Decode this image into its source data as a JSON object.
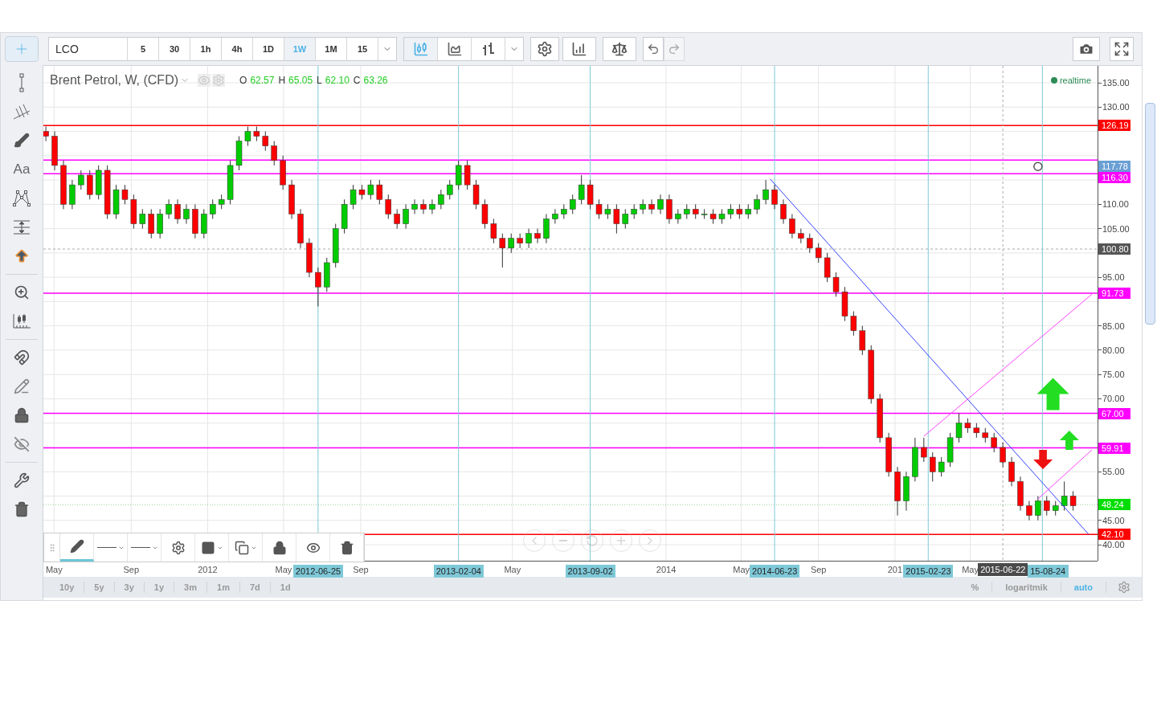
{
  "toolbar": {
    "symbol": "LCO",
    "intervals": [
      {
        "label": "5",
        "selected": false
      },
      {
        "label": "30",
        "selected": false
      },
      {
        "label": "1h",
        "selected": false
      },
      {
        "label": "4h",
        "selected": false
      },
      {
        "label": "1D",
        "selected": false
      },
      {
        "label": "1W",
        "selected": true
      },
      {
        "label": "1M",
        "selected": false
      },
      {
        "label": "15",
        "selected": false
      }
    ],
    "chart_styles": [
      {
        "kind": "candles",
        "selected": true
      },
      {
        "kind": "area",
        "selected": false
      },
      {
        "kind": "bars",
        "selected": false
      }
    ]
  },
  "left_tool_groups": [
    [
      {
        "kind": "crosshair",
        "selected": true
      },
      {
        "kind": "segment",
        "selected": false
      },
      {
        "kind": "pitchfork",
        "selected": false
      },
      {
        "kind": "brush",
        "selected": false
      },
      {
        "kind": "text",
        "label": "Aa",
        "selected": false
      },
      {
        "kind": "pattern",
        "selected": false
      },
      {
        "kind": "measure",
        "selected": false
      },
      {
        "kind": "arrow",
        "selected": false
      }
    ],
    [
      {
        "kind": "zoom",
        "selected": false
      },
      {
        "kind": "ruler",
        "selected": false
      }
    ],
    [
      {
        "kind": "magnet",
        "selected": false
      },
      {
        "kind": "pencils",
        "selected": false
      },
      {
        "kind": "lock",
        "selected": false
      },
      {
        "kind": "hide",
        "selected": false
      }
    ],
    [
      {
        "kind": "tools",
        "selected": false
      },
      {
        "kind": "trash",
        "selected": false
      }
    ]
  ],
  "legend": {
    "title": "Brent Petrol, W, (CFD)",
    "values": [
      {
        "key": "O",
        "value": "62.57"
      },
      {
        "key": "H",
        "value": "65.05"
      },
      {
        "key": "L",
        "value": "62.10"
      },
      {
        "key": "C",
        "value": "63.26"
      }
    ]
  },
  "status": {
    "label": "realtime",
    "color": "#2e8b57"
  },
  "cursor_price": "117.78",
  "chart_data": {
    "type": "candlestick",
    "grid": true,
    "x": [
      "2011-04-18",
      "2011-05-02",
      "2011-05-16",
      "2011-05-30",
      "2011-06-13",
      "2011-06-27",
      "2011-07-11",
      "2011-07-25",
      "2011-08-08",
      "2011-08-22",
      "2011-09-05",
      "2011-09-19",
      "2011-10-03",
      "2011-10-17",
      "2011-10-31",
      "2011-11-14",
      "2011-11-28",
      "2011-12-12",
      "2011-12-26",
      "2012-01-09",
      "2012-01-23",
      "2012-02-06",
      "2012-02-20",
      "2012-03-05",
      "2012-03-19",
      "2012-04-02",
      "2012-04-16",
      "2012-04-30",
      "2012-05-14",
      "2012-05-28",
      "2012-06-11",
      "2012-06-25",
      "2012-07-09",
      "2012-07-23",
      "2012-08-06",
      "2012-08-20",
      "2012-09-03",
      "2012-09-17",
      "2012-10-01",
      "2012-10-15",
      "2012-10-29",
      "2012-11-12",
      "2012-11-26",
      "2012-12-10",
      "2012-12-24",
      "2013-01-07",
      "2013-01-21",
      "2013-02-04",
      "2013-02-18",
      "2013-03-04",
      "2013-03-18",
      "2013-04-01",
      "2013-04-15",
      "2013-04-29",
      "2013-05-13",
      "2013-05-27",
      "2013-06-10",
      "2013-06-24",
      "2013-07-08",
      "2013-07-22",
      "2013-08-05",
      "2013-08-19",
      "2013-09-02",
      "2013-09-16",
      "2013-09-30",
      "2013-10-14",
      "2013-10-28",
      "2013-11-11",
      "2013-11-25",
      "2013-12-09",
      "2013-12-23",
      "2014-01-06",
      "2014-01-20",
      "2014-02-03",
      "2014-02-17",
      "2014-03-03",
      "2014-03-17",
      "2014-03-31",
      "2014-04-14",
      "2014-04-28",
      "2014-05-12",
      "2014-05-26",
      "2014-06-09",
      "2014-06-23",
      "2014-07-07",
      "2014-07-21",
      "2014-08-04",
      "2014-08-18",
      "2014-09-01",
      "2014-09-15",
      "2014-09-29",
      "2014-10-13",
      "2014-10-27",
      "2014-11-10",
      "2014-11-24",
      "2014-12-08",
      "2014-12-22",
      "2015-01-05",
      "2015-01-19",
      "2015-02-02",
      "2015-02-16",
      "2015-03-02",
      "2015-03-16",
      "2015-03-30",
      "2015-04-13",
      "2015-04-27",
      "2015-05-11",
      "2015-05-25",
      "2015-06-08",
      "2015-06-22",
      "2015-07-06",
      "2015-07-20",
      "2015-08-03",
      "2015-08-17",
      "2015-08-31",
      "2015-09-14",
      "2015-09-28",
      "2015-10-12"
    ],
    "ohlc": [
      [
        125,
        126,
        123,
        124
      ],
      [
        124,
        125,
        117,
        118
      ],
      [
        118,
        119,
        109,
        110
      ],
      [
        110,
        115,
        109,
        114
      ],
      [
        114,
        117,
        113,
        116
      ],
      [
        116,
        117,
        111,
        112
      ],
      [
        112,
        118,
        111,
        117
      ],
      [
        117,
        118,
        107,
        108
      ],
      [
        108,
        114,
        107,
        113
      ],
      [
        113,
        114,
        110,
        111
      ],
      [
        111,
        112,
        105,
        106
      ],
      [
        106,
        109,
        105,
        108
      ],
      [
        108,
        109,
        103,
        104
      ],
      [
        104,
        109,
        103,
        108
      ],
      [
        108,
        111,
        107,
        110
      ],
      [
        110,
        111,
        106,
        107
      ],
      [
        107,
        110,
        106,
        109
      ],
      [
        109,
        110,
        103,
        104
      ],
      [
        104,
        109,
        103,
        108
      ],
      [
        108,
        111,
        107,
        110
      ],
      [
        110,
        112,
        109,
        111
      ],
      [
        111,
        119,
        110,
        118
      ],
      [
        118,
        124,
        117,
        123
      ],
      [
        123,
        126,
        122,
        125
      ],
      [
        125,
        126,
        123,
        124
      ],
      [
        124,
        125,
        121,
        122
      ],
      [
        122,
        123,
        118,
        119
      ],
      [
        119,
        120,
        113,
        114
      ],
      [
        114,
        115,
        107,
        108
      ],
      [
        108,
        109,
        101,
        102
      ],
      [
        102,
        103,
        95,
        96
      ],
      [
        96,
        97,
        89,
        93
      ],
      [
        93,
        99,
        92,
        98
      ],
      [
        98,
        106,
        97,
        105
      ],
      [
        105,
        111,
        104,
        110
      ],
      [
        110,
        114,
        109,
        113
      ],
      [
        113,
        114,
        111,
        112
      ],
      [
        112,
        115,
        111,
        114
      ],
      [
        114,
        115,
        110,
        111
      ],
      [
        111,
        112,
        107,
        108
      ],
      [
        108,
        109,
        105,
        106
      ],
      [
        106,
        110,
        105,
        109
      ],
      [
        109,
        111,
        108,
        110
      ],
      [
        110,
        111,
        108,
        109
      ],
      [
        109,
        111,
        108,
        110
      ],
      [
        110,
        113,
        109,
        112
      ],
      [
        112,
        115,
        111,
        114
      ],
      [
        114,
        119,
        113,
        118
      ],
      [
        118,
        119,
        113,
        114
      ],
      [
        114,
        115,
        109,
        110
      ],
      [
        110,
        111,
        105,
        106
      ],
      [
        106,
        107,
        102,
        103
      ],
      [
        103,
        104,
        97,
        101
      ],
      [
        101,
        104,
        100,
        103
      ],
      [
        103,
        104,
        101,
        102
      ],
      [
        102,
        105,
        101,
        104
      ],
      [
        104,
        105,
        102,
        103
      ],
      [
        103,
        108,
        102,
        107
      ],
      [
        107,
        109,
        106,
        108
      ],
      [
        108,
        110,
        107,
        109
      ],
      [
        109,
        112,
        108,
        111
      ],
      [
        111,
        116,
        110,
        114
      ],
      [
        114,
        115,
        109,
        110
      ],
      [
        110,
        111,
        107,
        108
      ],
      [
        108,
        110,
        107,
        109
      ],
      [
        109,
        110,
        104,
        106
      ],
      [
        106,
        109,
        105,
        108
      ],
      [
        108,
        110,
        107,
        109
      ],
      [
        109,
        111,
        108,
        110
      ],
      [
        110,
        111,
        108,
        109
      ],
      [
        109,
        112,
        108,
        111
      ],
      [
        111,
        112,
        106,
        107
      ],
      [
        107,
        109,
        106,
        108
      ],
      [
        108,
        110,
        107,
        109
      ],
      [
        109,
        110,
        107,
        108
      ],
      [
        108,
        109,
        107,
        108
      ],
      [
        108,
        109,
        106,
        107
      ],
      [
        107,
        109,
        106,
        108
      ],
      [
        108,
        110,
        107,
        109
      ],
      [
        109,
        110,
        107,
        108
      ],
      [
        108,
        110,
        107,
        109
      ],
      [
        109,
        112,
        108,
        111
      ],
      [
        111,
        115,
        110,
        113
      ],
      [
        113,
        114,
        109,
        110
      ],
      [
        110,
        111,
        106,
        107
      ],
      [
        107,
        108,
        103,
        104
      ],
      [
        104,
        105,
        102,
        103
      ],
      [
        103,
        104,
        100,
        101
      ],
      [
        101,
        102,
        98,
        99
      ],
      [
        99,
        100,
        94,
        95
      ],
      [
        95,
        96,
        91,
        92
      ],
      [
        92,
        93,
        86,
        87
      ],
      [
        87,
        88,
        83,
        84
      ],
      [
        84,
        85,
        79,
        80
      ],
      [
        80,
        81,
        69,
        70
      ],
      [
        70,
        71,
        61,
        62
      ],
      [
        62,
        63,
        54,
        55
      ],
      [
        55,
        56,
        46,
        49
      ],
      [
        49,
        55,
        47,
        54
      ],
      [
        54,
        62,
        53,
        60
      ],
      [
        60,
        62,
        57,
        58
      ],
      [
        58,
        59,
        53,
        55
      ],
      [
        55,
        58,
        54,
        57
      ],
      [
        57,
        63,
        56,
        62
      ],
      [
        62,
        67,
        61,
        65
      ],
      [
        65,
        66,
        63,
        64
      ],
      [
        64,
        65,
        62,
        63
      ],
      [
        63,
        64,
        61,
        62
      ],
      [
        62,
        63,
        59,
        60
      ],
      [
        60,
        61,
        56,
        57
      ],
      [
        57,
        58,
        52,
        53
      ],
      [
        53,
        54,
        47,
        48
      ],
      [
        48,
        49,
        45,
        46
      ],
      [
        46,
        50,
        45,
        49
      ],
      [
        49,
        50,
        46,
        47
      ],
      [
        47,
        49,
        46,
        48
      ],
      [
        48,
        53,
        47,
        50
      ],
      [
        50,
        51,
        47,
        48
      ]
    ],
    "xlim": [
      "2011-04-14",
      "2015-11-20"
    ],
    "ylim": [
      36.7,
      138.47
    ],
    "xticks": [
      {
        "value": "2011-05-01",
        "label": "May"
      },
      {
        "value": "2011-09-01",
        "label": "Sep"
      },
      {
        "value": "2012-01-01",
        "label": "2012"
      },
      {
        "value": "2012-05-01",
        "label": "May"
      },
      {
        "value": "2012-09-01",
        "label": "Sep"
      },
      {
        "value": "2013-05-01",
        "label": "May"
      },
      {
        "value": "2014-01-01",
        "label": "2014"
      },
      {
        "value": "2014-05-01",
        "label": "May"
      },
      {
        "value": "2014-09-01",
        "label": "Sep"
      },
      {
        "value": "2015-01-01",
        "label": "201"
      },
      {
        "value": "2015-05-01",
        "label": "May"
      }
    ],
    "yticks": [
      {
        "value": 135,
        "label": "135.00"
      },
      {
        "value": 130,
        "label": "130.00"
      },
      {
        "value": 110,
        "label": "110.00"
      },
      {
        "value": 105,
        "label": "105.00"
      },
      {
        "value": 95,
        "label": "95.00"
      },
      {
        "value": 85,
        "label": "85.00"
      },
      {
        "value": 80,
        "label": "80.00"
      },
      {
        "value": 75,
        "label": "75.00"
      },
      {
        "value": 70,
        "label": "70.00"
      },
      {
        "value": 55,
        "label": "55.00"
      },
      {
        "value": 45,
        "label": "45.00"
      },
      {
        "value": 40,
        "label": "40.00"
      }
    ],
    "ref_lines": [
      {
        "axis": "y",
        "value": 126.19,
        "color": "#ff0000",
        "label": "126.19"
      },
      {
        "axis": "y",
        "value": 119.1,
        "color": "#ff00ff"
      },
      {
        "axis": "y",
        "value": 116.3,
        "color": "#ff00ff",
        "label": "116.30"
      },
      {
        "axis": "y",
        "value": 100.8,
        "color": "#aaaaaa",
        "label": "100.80"
      },
      {
        "axis": "y",
        "value": 91.73,
        "color": "#ff00ff",
        "label": "91.73"
      },
      {
        "axis": "y",
        "value": 67.0,
        "color": "#ff00ff",
        "label": "67.00"
      },
      {
        "axis": "y",
        "value": 59.91,
        "color": "#ff00ff",
        "label": "59.91"
      },
      {
        "axis": "y",
        "value": 48.24,
        "color": "#99cc99",
        "label": "48.24"
      },
      {
        "axis": "y",
        "value": 42.1,
        "color": "#ff0000",
        "label": "42.10"
      },
      {
        "axis": "x",
        "value": "2012-06-25",
        "color": "#7ec8d8",
        "label": "2012-06-25"
      },
      {
        "axis": "x",
        "value": "2013-02-04",
        "color": "#7ec8d8",
        "label": "2013-02-04"
      },
      {
        "axis": "x",
        "value": "2013-09-02",
        "color": "#7ec8d8",
        "label": "2013-09-02"
      },
      {
        "axis": "x",
        "value": "2014-06-23",
        "color": "#7ec8d8",
        "label": "2014-06-23"
      },
      {
        "axis": "x",
        "value": "2015-02-23",
        "color": "#7ec8d8",
        "label": "2015-02-23"
      },
      {
        "axis": "x",
        "value": "2015-06-22",
        "color": "#aaaaaa",
        "label": "2015-06-22"
      },
      {
        "axis": "x",
        "value": "2015-08-24",
        "color": "#7ec8d8",
        "label": "15-08-24"
      }
    ]
  },
  "drawing_toolbar": [
    {
      "kind": "pencil",
      "selected": true
    },
    {
      "kind": "line-style",
      "selected": false
    },
    {
      "kind": "line-width",
      "selected": false
    },
    {
      "kind": "settings",
      "selected": false
    },
    {
      "kind": "fill",
      "selected": false
    },
    {
      "kind": "layers",
      "selected": false
    },
    {
      "kind": "lock",
      "selected": false
    },
    {
      "kind": "eye",
      "selected": false
    },
    {
      "kind": "trash",
      "selected": false
    }
  ],
  "ranges": [
    "10y",
    "5y",
    "3y",
    "1y",
    "3m",
    "1m",
    "7d",
    "1d"
  ],
  "scale_options": [
    {
      "label": "%",
      "selected": false
    },
    {
      "label": "logaritmik",
      "selected": false
    },
    {
      "label": "auto",
      "selected": true
    }
  ]
}
